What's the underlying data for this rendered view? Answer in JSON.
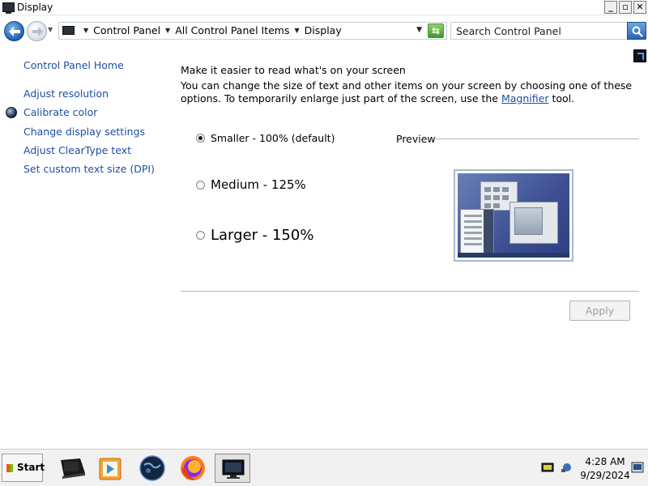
{
  "window": {
    "title": "Display"
  },
  "window_buttons": {
    "minimize": "_",
    "maximize": "▫",
    "close": "✕"
  },
  "address_bar": {
    "crumbs": [
      "Control Panel",
      "All Control Panel Items",
      "Display"
    ]
  },
  "search": {
    "placeholder": "Search Control Panel"
  },
  "sidebar": {
    "items": [
      {
        "label": "Control Panel Home",
        "icon": null
      },
      {
        "label": "Adjust resolution",
        "icon": null
      },
      {
        "label": "Calibrate color",
        "icon": "shield-icon"
      },
      {
        "label": "Change display settings",
        "icon": null
      },
      {
        "label": "Adjust ClearType text",
        "icon": null
      },
      {
        "label": "Set custom text size (DPI)",
        "icon": null
      }
    ]
  },
  "main": {
    "heading": "Make it easier to read what's on your screen",
    "description_before": "You can change the size of text and other items on your screen by choosing one of these options. To temporarily enlarge just part of the screen, use the ",
    "description_link": "Magnifier",
    "description_after": " tool.",
    "options": [
      {
        "label": "Smaller - 100% (default)",
        "checked": true
      },
      {
        "label": "Medium - 125%",
        "checked": false
      },
      {
        "label": "Larger - 150%",
        "checked": false
      }
    ],
    "preview_label": "Preview",
    "apply_label": "Apply"
  },
  "taskbar": {
    "start_label": "Start",
    "apps": [
      "notebook-icon",
      "media-player-icon",
      "globe-icon",
      "firefox-icon",
      "display-icon"
    ],
    "active_app": "display-icon"
  },
  "clock": {
    "time": "4:28 AM",
    "date": "9/29/2024"
  },
  "colors": {
    "link": "#1f4ea3",
    "accent": "#2a62b2"
  }
}
